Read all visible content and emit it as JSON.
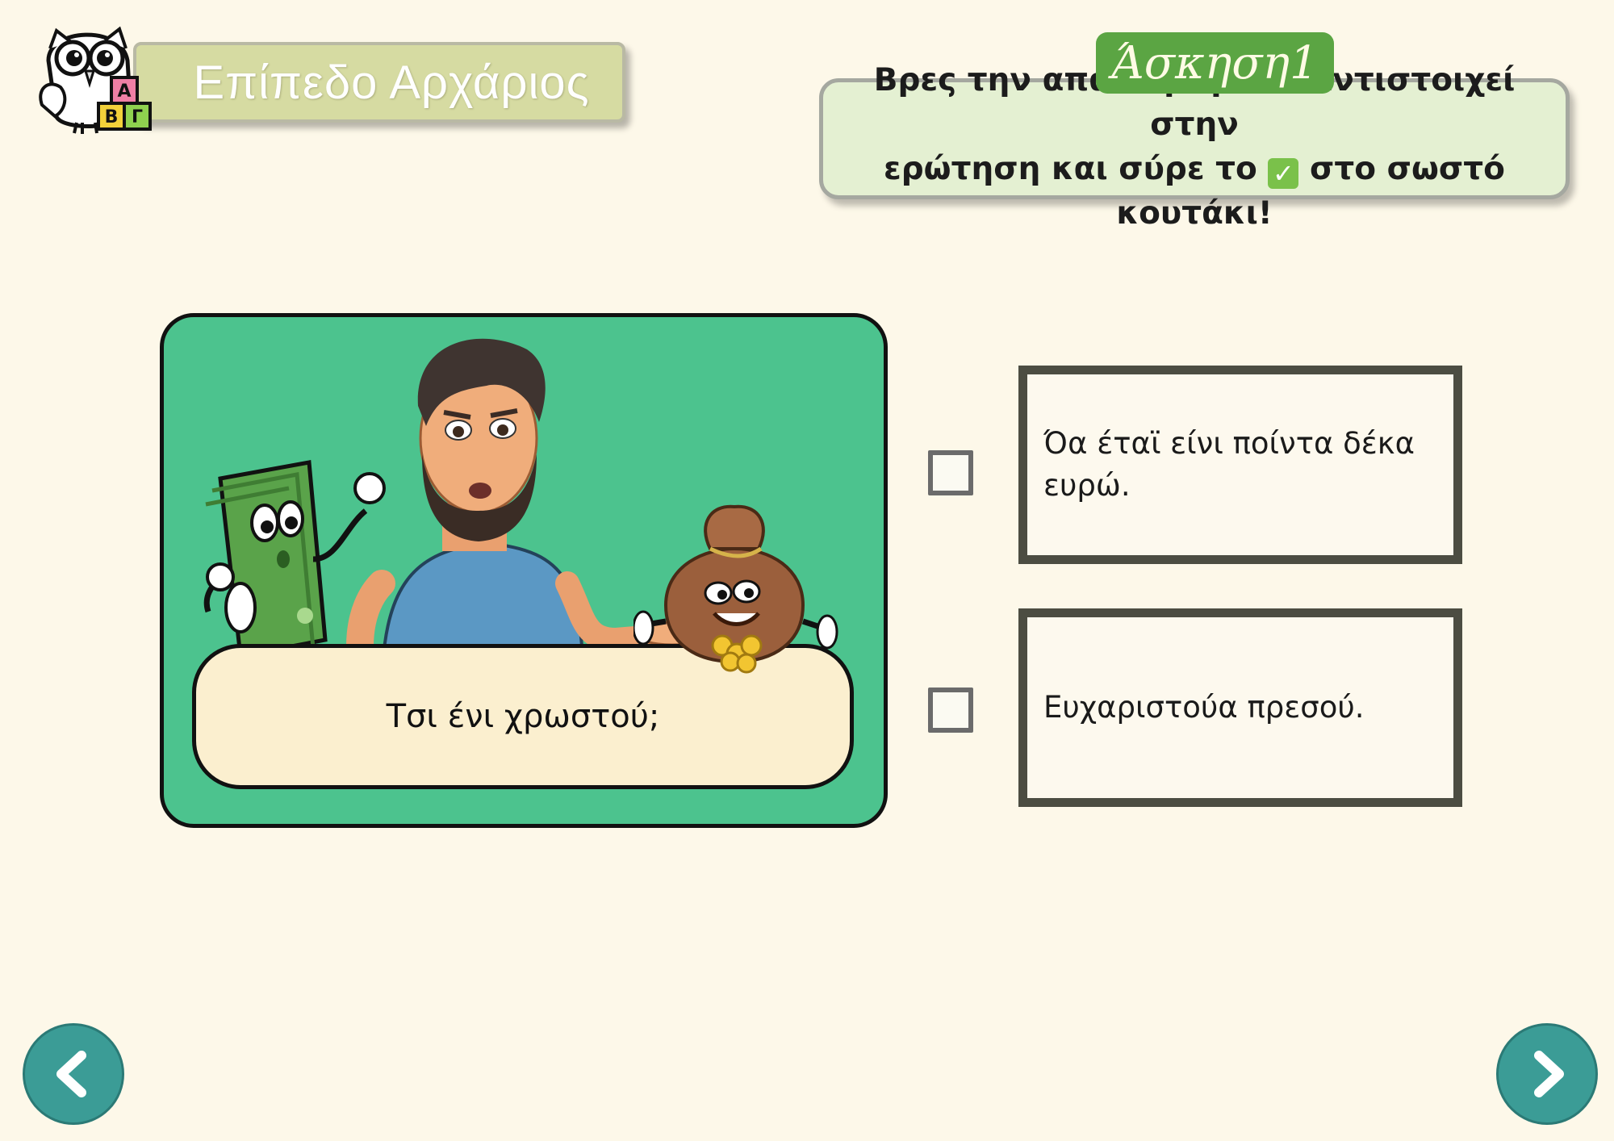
{
  "header": {
    "level_label": "Επίπεδο Αρχάριος",
    "logo_letters": [
      "Α",
      "Β",
      "Γ"
    ]
  },
  "exercise": {
    "badge": "Άσκηση1",
    "instruction_part1": "Βρες την απάντηση που αντιστοιχεί στην",
    "instruction_part2": "ερώτηση και σύρε το",
    "instruction_check": "✓",
    "instruction_part3": "στο σωστό κουτάκι!"
  },
  "question": {
    "text": "Τσι ένι χρωστού;"
  },
  "answers": [
    {
      "text": "Όα έταϊ είνι ποίντα δέκα ευρώ.",
      "checked": false
    },
    {
      "text": "Ευχαριστούα πρεσού.",
      "checked": false
    }
  ],
  "navigation": {
    "prev_icon": "chevron-left-icon",
    "next_icon": "chevron-right-icon"
  },
  "colors": {
    "background": "#fdf8e9",
    "card_green": "#4cc38e",
    "badge_green": "#5ba543",
    "nav_teal": "#3b9c96",
    "answer_border": "#4c4d42"
  }
}
